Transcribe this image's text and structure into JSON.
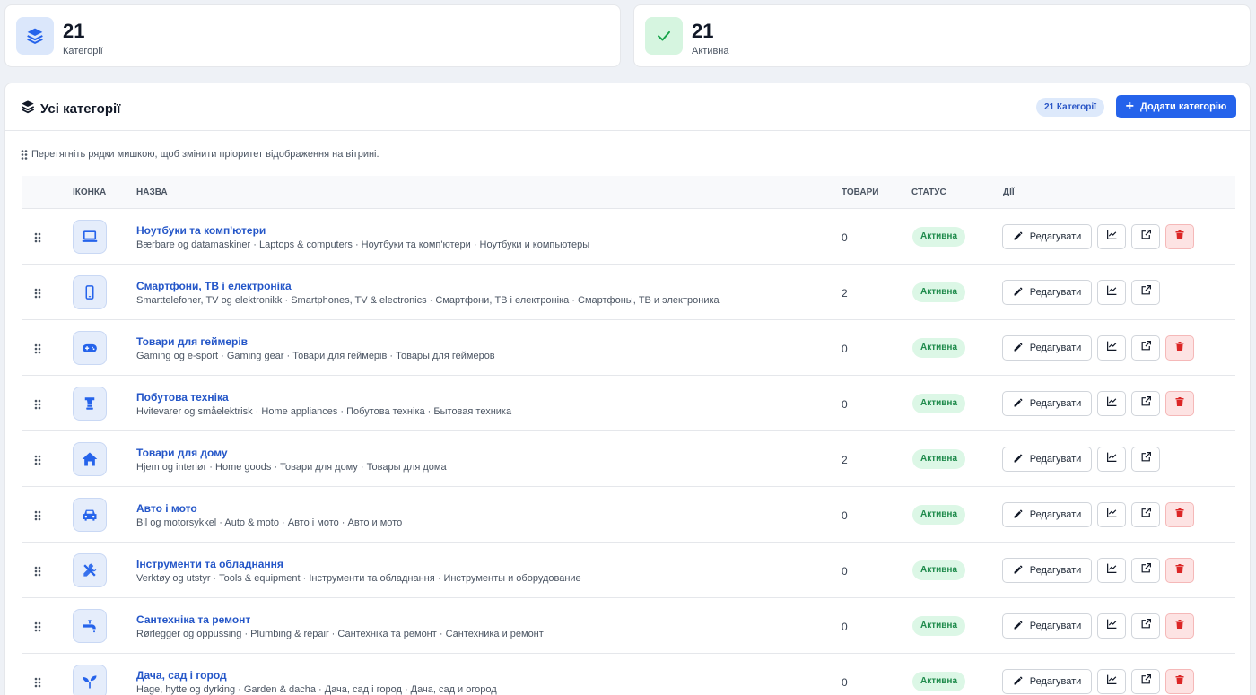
{
  "stats": [
    {
      "value": "21",
      "label": "Категорії",
      "icon": "layers-icon"
    },
    {
      "value": "21",
      "label": "Активна",
      "icon": "check-icon"
    }
  ],
  "panel": {
    "title": "Усі категорії",
    "count_badge": "21 Категорії",
    "add_button": "Додати категорію",
    "hint": "Перетягніть рядки мишкою, щоб змінити пріоритет відображення на вітрині."
  },
  "columns": {
    "icon": "ІКОНКА",
    "name": "НАЗВА",
    "products": "ТОВАРИ",
    "status": "СТАТУС",
    "actions": "ДІЇ"
  },
  "edit_label": "Редагувати",
  "colors": {
    "accent": "#2563eb",
    "status_bg": "#dcf7e6",
    "status_text": "#1f8b4c",
    "delete_bg": "#fde3e3",
    "delete_icon": "#dc2626"
  },
  "rows": [
    {
      "name": "Ноутбуки та комп'ютери",
      "sub": "Bærbare og datamaskiner · Laptops & computers · Ноутбуки та комп'ютери · Ноутбуки и компьютеры",
      "count": "0",
      "status": "Активна",
      "icon": "laptop-icon",
      "deletable": true
    },
    {
      "name": "Смартфони, ТВ і електроніка",
      "sub": "Smarttelefoner, TV og elektronikk · Smartphones, TV & electronics · Смартфони, ТВ і електроніка · Смартфоны, ТВ и электроника",
      "count": "2",
      "status": "Активна",
      "icon": "smartphone-icon",
      "deletable": false
    },
    {
      "name": "Товари для геймерів",
      "sub": "Gaming og e-sport · Gaming gear · Товари для геймерів · Товары для геймеров",
      "count": "0",
      "status": "Активна",
      "icon": "gamepad-icon",
      "deletable": true
    },
    {
      "name": "Побутова техніка",
      "sub": "Hvitevarer og småelektrisk · Home appliances · Побутова техніка · Бытовая техника",
      "count": "0",
      "status": "Активна",
      "icon": "blender-icon",
      "deletable": true
    },
    {
      "name": "Товари для дому",
      "sub": "Hjem og interiør · Home goods · Товари для дому · Товары для дома",
      "count": "2",
      "status": "Активна",
      "icon": "home-icon",
      "deletable": false
    },
    {
      "name": "Авто і мото",
      "sub": "Bil og motorsykkel · Auto & moto · Авто і мото · Авто и мото",
      "count": "0",
      "status": "Активна",
      "icon": "car-icon",
      "deletable": true
    },
    {
      "name": "Інструменти та обладнання",
      "sub": "Verktøy og utstyr · Tools & equipment · Інструменти та обладнання · Инструменты и оборудование",
      "count": "0",
      "status": "Активна",
      "icon": "tools-icon",
      "deletable": true
    },
    {
      "name": "Сантехніка та ремонт",
      "sub": "Rørlegger og oppussing · Plumbing & repair · Сантехніка та ремонт · Сантехника и ремонт",
      "count": "0",
      "status": "Активна",
      "icon": "faucet-icon",
      "deletable": true
    },
    {
      "name": "Дача, сад і город",
      "sub": "Hage, hytte og dyrking · Garden & dacha · Дача, сад і город · Дача, сад и огород",
      "count": "0",
      "status": "Активна",
      "icon": "seedling-icon",
      "deletable": true
    }
  ]
}
